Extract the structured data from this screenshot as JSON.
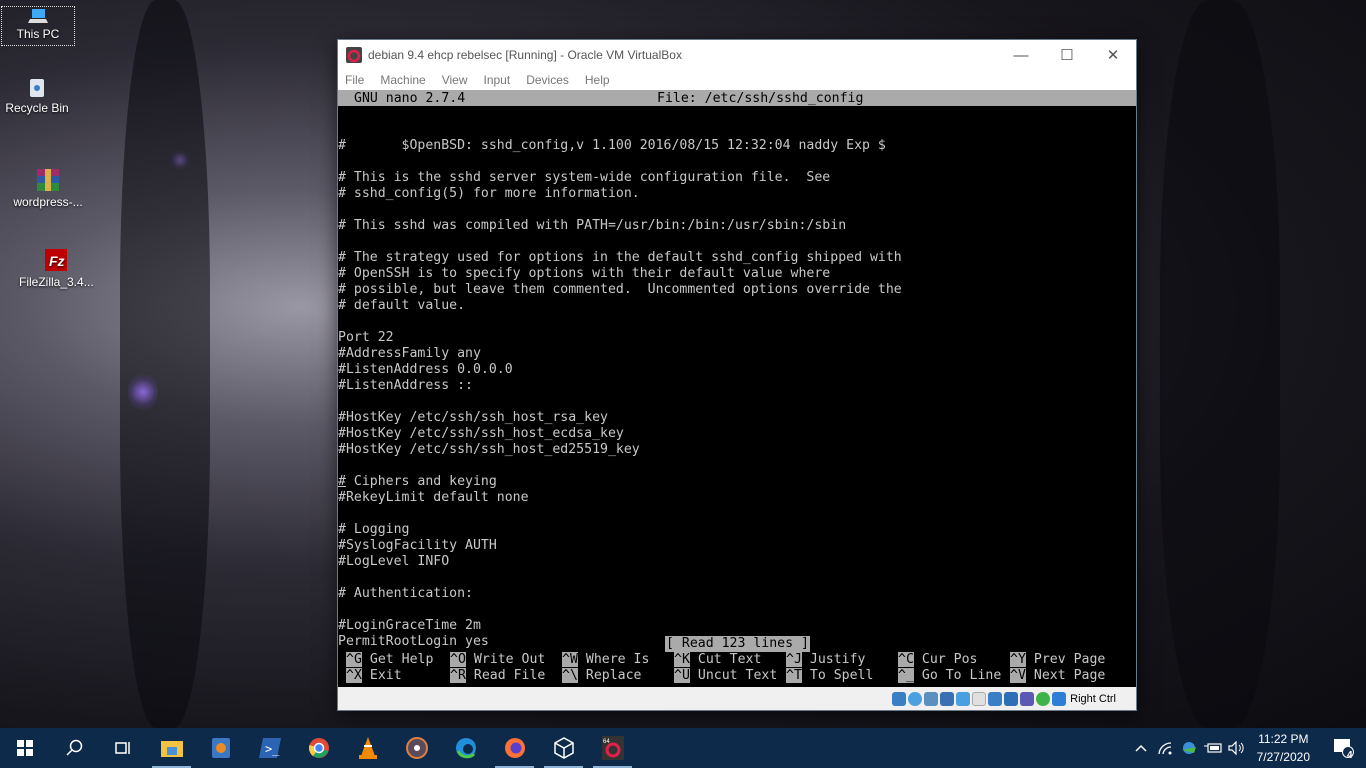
{
  "desktop": {
    "icons": [
      {
        "label": "This PC",
        "icon": "computer-icon"
      },
      {
        "label": "Recycle Bin",
        "icon": "recycle-bin-icon"
      },
      {
        "label": "wordpress-...",
        "icon": "winrar-archive-icon"
      },
      {
        "label": "FileZilla_3.4...",
        "icon": "filezilla-icon"
      }
    ]
  },
  "window": {
    "title": "debian 9.4 ehcp rebelsec [Running] - Oracle VM VirtualBox",
    "controls": {
      "minimize": "—",
      "maximize": "☐",
      "close": "✕"
    },
    "menu": [
      "File",
      "Machine",
      "View",
      "Input",
      "Devices",
      "Help"
    ],
    "status_bar": {
      "host_key": "Right Ctrl"
    }
  },
  "nano": {
    "version": "GNU nano 2.7.4",
    "file": "File: /etc/ssh/sshd_config",
    "lines": [
      "",
      "#       $OpenBSD: sshd_config,v 1.100 2016/08/15 12:32:04 naddy Exp $",
      "",
      "# This is the sshd server system-wide configuration file.  See",
      "# sshd_config(5) for more information.",
      "",
      "# This sshd was compiled with PATH=/usr/bin:/bin:/usr/sbin:/sbin",
      "",
      "# The strategy used for options in the default sshd_config shipped with",
      "# OpenSSH is to specify options with their default value where",
      "# possible, but leave them commented.  Uncommented options override the",
      "# default value.",
      "",
      "Port 22",
      "#AddressFamily any",
      "#ListenAddress 0.0.0.0",
      "#ListenAddress ::",
      "",
      "#HostKey /etc/ssh/ssh_host_rsa_key",
      "#HostKey /etc/ssh/ssh_host_ecdsa_key",
      "#HostKey /etc/ssh/ssh_host_ed25519_key",
      "",
      "# Ciphers and keying",
      "#RekeyLimit default none",
      "",
      "# Logging",
      "#SyslogFacility AUTH",
      "#LogLevel INFO",
      "",
      "# Authentication:",
      "",
      "#LoginGraceTime 2m",
      "PermitRootLogin yes"
    ],
    "status_message": "[ Read 123 lines ]",
    "shortcuts_row1": [
      {
        "key": "^G",
        "label": "Get Help"
      },
      {
        "key": "^O",
        "label": "Write Out"
      },
      {
        "key": "^W",
        "label": "Where Is"
      },
      {
        "key": "^K",
        "label": "Cut Text"
      },
      {
        "key": "^J",
        "label": "Justify"
      },
      {
        "key": "^C",
        "label": "Cur Pos"
      },
      {
        "key": "^Y",
        "label": "Prev Page"
      }
    ],
    "shortcuts_row2": [
      {
        "key": "^X",
        "label": "Exit"
      },
      {
        "key": "^R",
        "label": "Read File"
      },
      {
        "key": "^\\",
        "label": "Replace"
      },
      {
        "key": "^U",
        "label": "Uncut Text"
      },
      {
        "key": "^T",
        "label": "To Spell"
      },
      {
        "key": "^_",
        "label": "Go To Line"
      },
      {
        "key": "^V",
        "label": "Next Page"
      }
    ]
  },
  "taskbar": {
    "items": [
      "start",
      "search",
      "task-view",
      "file-explorer",
      "media-player",
      "powershell",
      "chrome",
      "vlc",
      "groove-music",
      "edge",
      "firefox",
      "virtualbox",
      "debian-vm"
    ],
    "tray": {
      "time": "11:22 PM",
      "date": "7/27/2020",
      "notifications": "4"
    }
  }
}
